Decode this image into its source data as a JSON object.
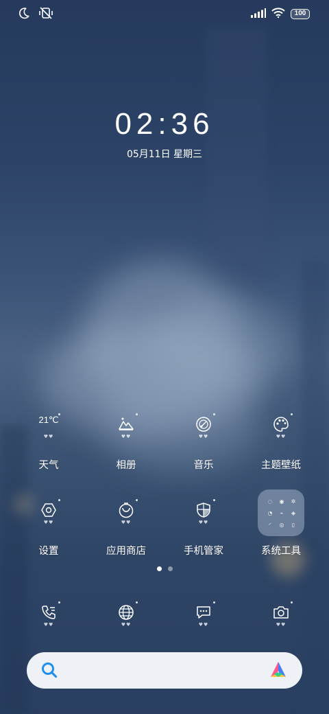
{
  "status_bar": {
    "left_icons": [
      "moon-icon",
      "vibrate-off-icon"
    ],
    "right_icons": [
      "signal-icon",
      "wifi-icon",
      "battery-icon"
    ],
    "battery": "100"
  },
  "lock": {
    "time": "02:36",
    "date": "05月11日 星期三"
  },
  "apps_row1": [
    {
      "label": "天气",
      "icon": "weather-icon",
      "value": "21℃"
    },
    {
      "label": "相册",
      "icon": "gallery-icon"
    },
    {
      "label": "音乐",
      "icon": "music-icon"
    },
    {
      "label": "主题壁纸",
      "icon": "theme-palette-icon"
    }
  ],
  "apps_row2": [
    {
      "label": "设置",
      "icon": "settings-icon"
    },
    {
      "label": "应用商店",
      "icon": "app-store-icon"
    },
    {
      "label": "手机管家",
      "icon": "security-shield-icon"
    },
    {
      "label": "系统工具",
      "icon": "folder-icon"
    }
  ],
  "dock": [
    {
      "icon": "phone-icon"
    },
    {
      "icon": "browser-icon"
    },
    {
      "icon": "messages-icon"
    },
    {
      "icon": "camera-icon"
    }
  ],
  "page_indicator": {
    "pages": 2,
    "current": 1
  },
  "search_bar": {
    "left_icon": "search-icon",
    "right_icon": "assistant-logo-icon"
  },
  "colors": {
    "accent_blue": "#1e8ff0",
    "search_bg": "#eef2f7"
  }
}
